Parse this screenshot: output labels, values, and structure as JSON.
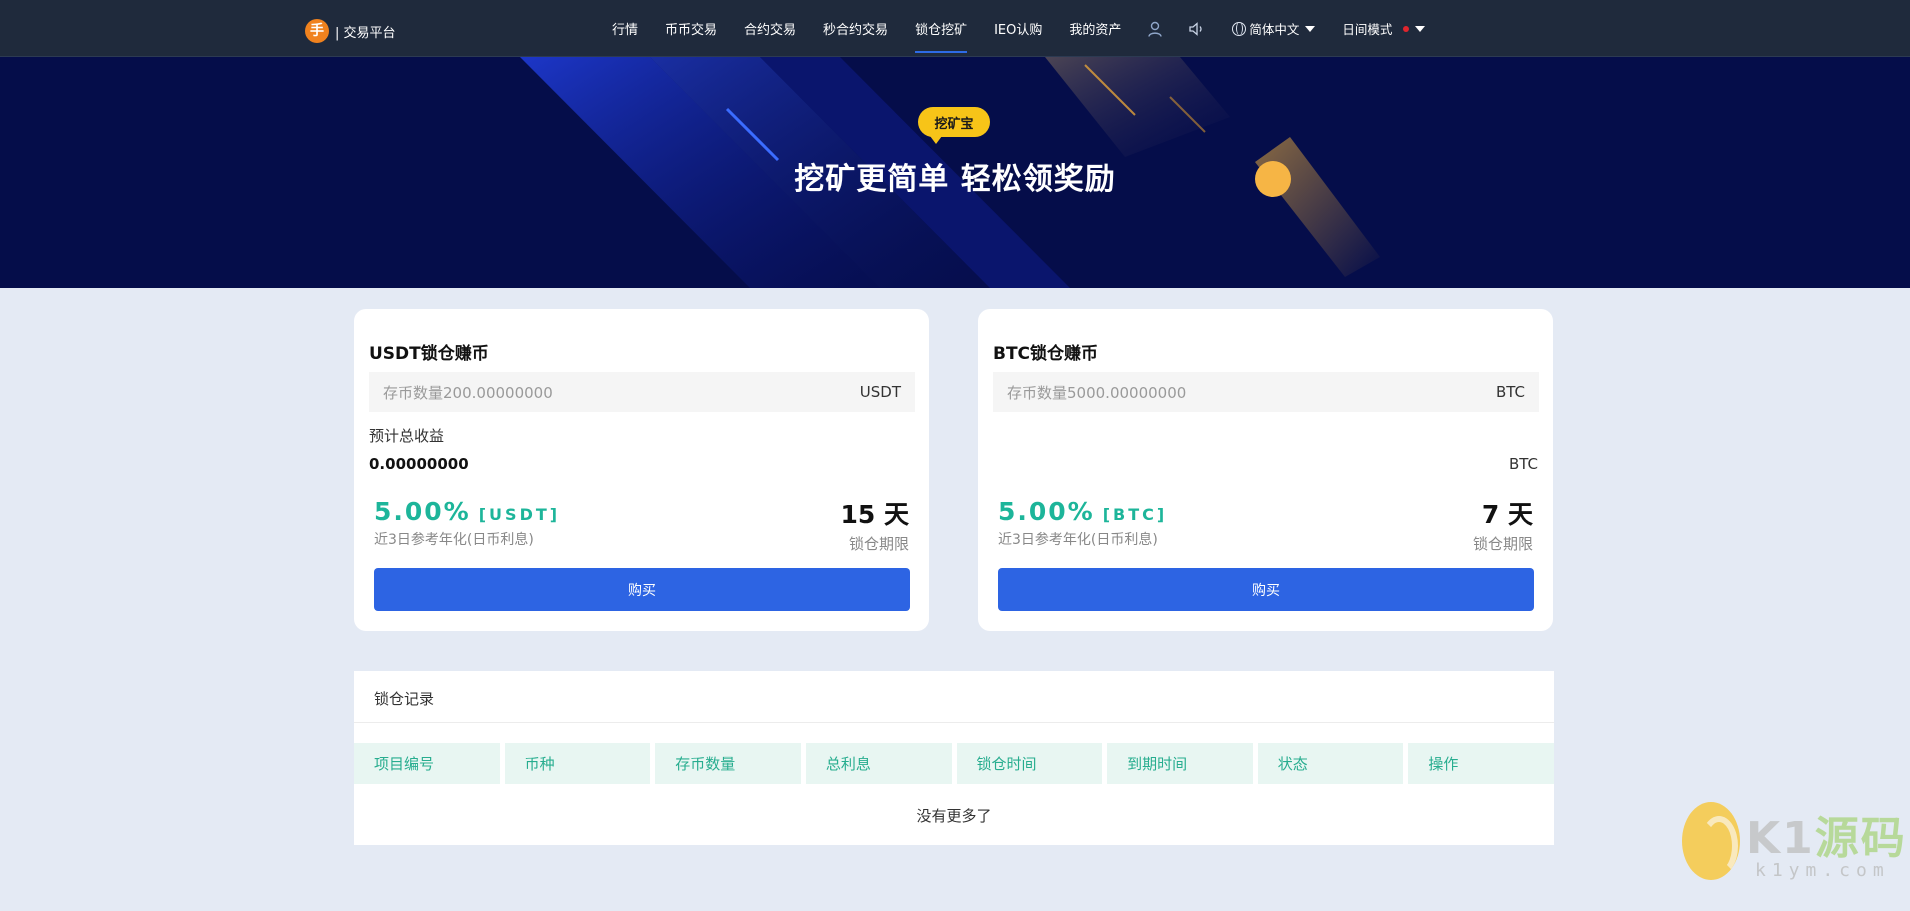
{
  "nav": {
    "logo_glyph": "手",
    "brand": "| 交易平台",
    "items": [
      {
        "label": "行情",
        "active": false
      },
      {
        "label": "币币交易",
        "active": false
      },
      {
        "label": "合约交易",
        "active": false
      },
      {
        "label": "秒合约交易",
        "active": false
      },
      {
        "label": "锁仓挖矿",
        "active": true
      },
      {
        "label": "IEO认购",
        "active": false
      },
      {
        "label": "我的资产",
        "active": false
      }
    ],
    "user_icon": "user-icon",
    "sound_icon": "speaker-icon",
    "language": "简体中文",
    "theme": "日间模式"
  },
  "hero": {
    "badge": "挖矿宝",
    "title": "挖矿更简单 轻松领奖励"
  },
  "cards": [
    {
      "title": "USDT锁仓赚币",
      "deposit_placeholder": "存币数量200.00000000",
      "deposit_unit": "USDT",
      "income_label": "预计总收益",
      "income_value": "0.00000000",
      "income_unit": "",
      "rate": "5.00%",
      "rate_unit": "[USDT]",
      "rate_desc": "近3日参考年化(日币利息)",
      "days": "15 天",
      "days_desc": "锁仓期限",
      "buy": "购买"
    },
    {
      "title": "BTC锁仓赚币",
      "deposit_placeholder": "存币数量5000.00000000",
      "deposit_unit": "BTC",
      "income_label": "",
      "income_value": "",
      "income_unit": "BTC",
      "rate": "5.00%",
      "rate_unit": "[BTC]",
      "rate_desc": "近3日参考年化(日币利息)",
      "days": "7 天",
      "days_desc": "锁仓期限",
      "buy": "购买"
    }
  ],
  "records": {
    "title": "锁仓记录",
    "columns": [
      "项目编号",
      "币种",
      "存币数量",
      "总利息",
      "锁仓时间",
      "到期时间",
      "状态",
      "操作"
    ],
    "empty": "没有更多了"
  },
  "watermark": {
    "text_a": "K1",
    "text_b": "源码",
    "sub": "k1ym.com"
  },
  "colors": {
    "nav_bg": "#1f2a3c",
    "hero_bg": "#050d4a",
    "accent_blue": "#2d64e3",
    "rate_green": "#1db59a",
    "badge_yellow": "#f7c418"
  }
}
